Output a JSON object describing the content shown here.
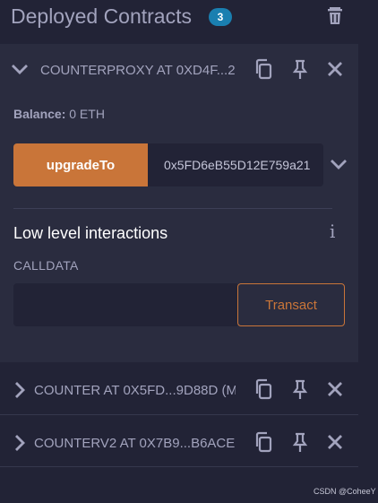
{
  "header": {
    "title": "Deployed Contracts",
    "count": "3"
  },
  "contracts": [
    {
      "label": "COUNTERPROXY AT 0XD4F...2",
      "expanded": true
    },
    {
      "label": "COUNTER AT 0X5FD...9D88D (M",
      "expanded": false
    },
    {
      "label": "COUNTERV2 AT 0X7B9...B6ACE",
      "expanded": false
    }
  ],
  "expanded_contract": {
    "balance_label": "Balance:",
    "balance_value": "0 ETH",
    "function_button": "upgradeTo",
    "function_input_value": "0x5FD6eB55D12E759a21",
    "low_level_title": "Low level interactions",
    "info_glyph": "i",
    "calldata_label": "CALLDATA",
    "calldata_value": "",
    "transact_button": "Transact"
  },
  "watermark": "CSDN @CoheeY",
  "colors": {
    "background": "#222336",
    "panel": "#2a2c3f",
    "accent": "#c97539",
    "badge": "#1a7fb0",
    "text": "#a2a3bd"
  }
}
